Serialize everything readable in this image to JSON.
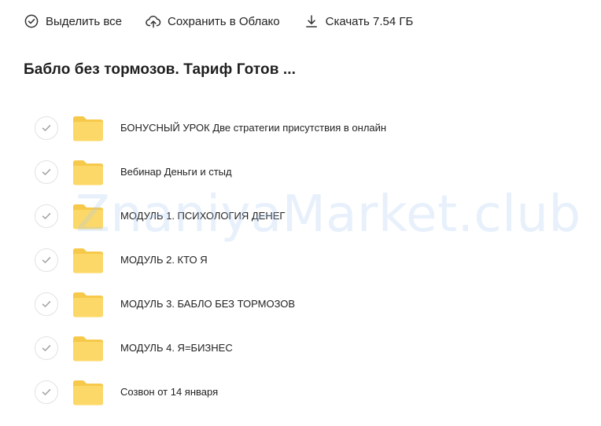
{
  "toolbar": {
    "select_all_label": "Выделить все",
    "save_cloud_label": "Сохранить в Облако",
    "download_label": "Скачать 7.54 ГБ"
  },
  "folder_title": "Бабло без тормозов. Тариф Готов ...",
  "items": [
    {
      "name": "БОНУСНЫЙ УРОК Две стратегии присутствия в онлайн",
      "type": "folder"
    },
    {
      "name": "Вебинар Деньги и стыд",
      "type": "folder"
    },
    {
      "name": "МОДУЛЬ 1. ПСИХОЛОГИЯ ДЕНЕГ",
      "type": "folder"
    },
    {
      "name": "МОДУЛЬ 2. КТО Я",
      "type": "folder"
    },
    {
      "name": "МОДУЛЬ 3. БАБЛО БЕЗ ТОРМОЗОВ",
      "type": "folder"
    },
    {
      "name": "МОДУЛЬ 4. Я=БИЗНЕС",
      "type": "folder"
    },
    {
      "name": "Созвон от 14 января",
      "type": "folder"
    }
  ],
  "watermark": "ZnaniyaMarket.club",
  "colors": {
    "folder": "#fcd869",
    "folder_tab": "#f6c94a",
    "check": "#9e9e9e",
    "watermark": "#aac8f0"
  }
}
